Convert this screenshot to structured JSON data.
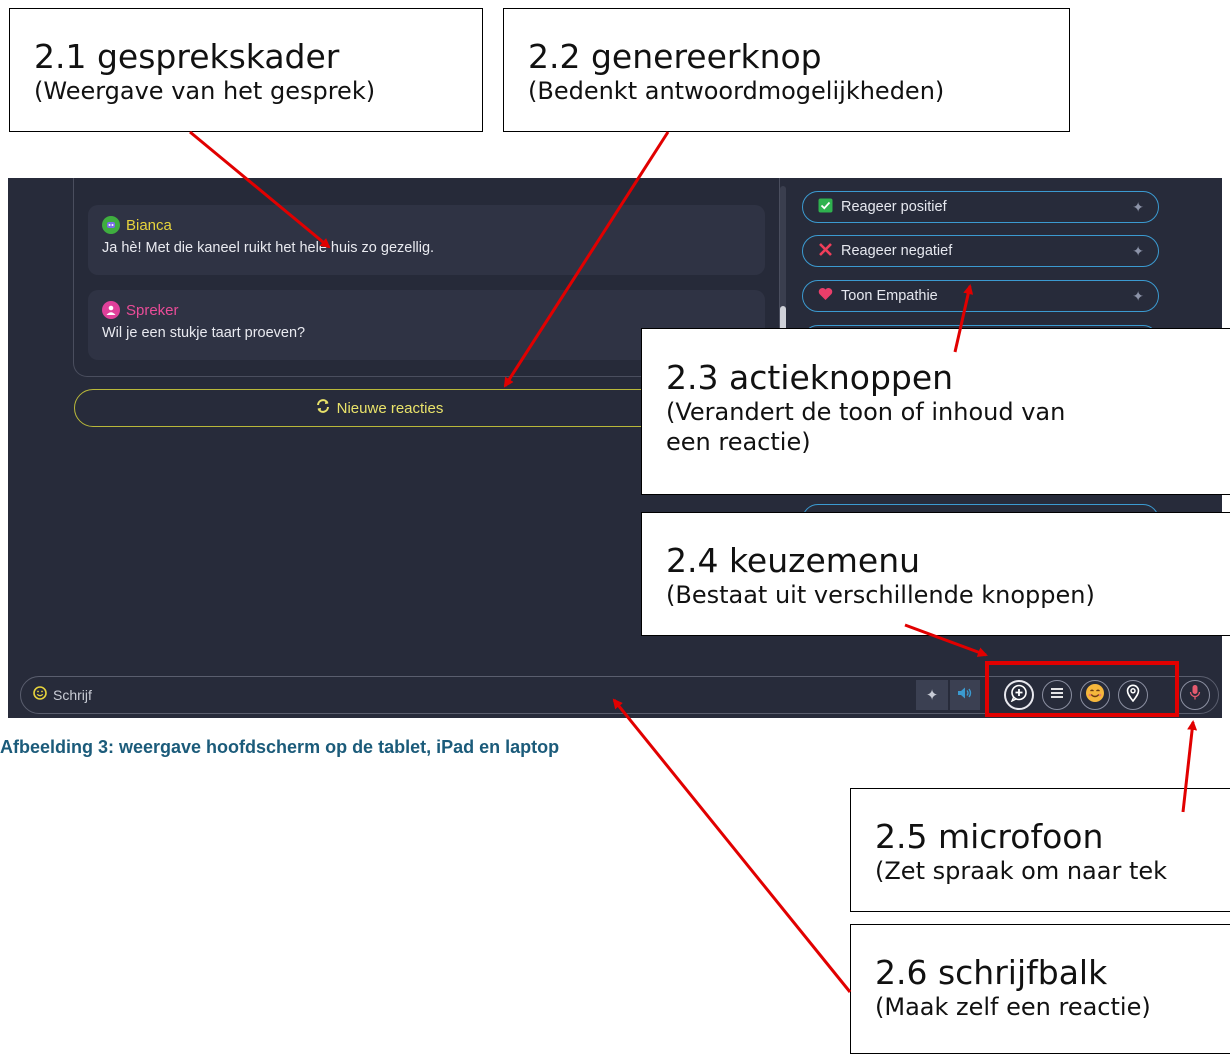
{
  "callouts": {
    "c21": {
      "title": "2.1 gesprekskader",
      "sub": "(Weergave van het gesprek)"
    },
    "c22": {
      "title": "2.2 genereerknop",
      "sub": "(Bedenkt antwoordmogelijkheden)"
    },
    "c23": {
      "title": "2.3 actieknoppen",
      "sub1": "(Verandert de toon of inhoud van",
      "sub2": "een reactie)"
    },
    "c24": {
      "title": "2.4 keuzemenu",
      "sub": "(Bestaat uit verschillende knoppen)"
    },
    "c25": {
      "title": "2.5 microfoon",
      "sub": "(Zet spraak om naar tek"
    },
    "c26": {
      "title": "2.6 schrijfbalk",
      "sub": "(Maak zelf een reactie)"
    }
  },
  "chat": {
    "messages": [
      {
        "sender": "Bianca",
        "text": "Ja hè! Met die kaneel ruikt het hele huis zo gezellig.",
        "color": "#e6d33c",
        "avatar_color": "#3fae3f"
      },
      {
        "sender": "Spreker",
        "text": "Wil je een stukje taart proeven?",
        "color": "#ea4c98",
        "avatar_color": "#e0409a"
      }
    ]
  },
  "generate_button": {
    "label": "Nieuwe reacties",
    "icon": "refresh-icon"
  },
  "actions": [
    {
      "label": "Reageer positief",
      "icon": "check-icon"
    },
    {
      "label": "Reageer negatief",
      "icon": "x-icon"
    },
    {
      "label": "Toon Empathie",
      "icon": "heart-icon"
    }
  ],
  "input": {
    "placeholder": "Schrijf"
  },
  "toolbar": {
    "icons": [
      "wand-icon",
      "speaker-icon",
      "add-chat-icon",
      "menu-icon",
      "emoji-icon",
      "location-icon",
      "microphone-icon"
    ]
  },
  "caption": "Afbeelding 3: weergave hoofdscherm op de tablet, iPad en laptop",
  "colors": {
    "app_bg": "#272b3a",
    "accent_blue": "#3b9ad0",
    "accent_yellow": "#e9e36a",
    "annotation_red": "#e10000"
  }
}
